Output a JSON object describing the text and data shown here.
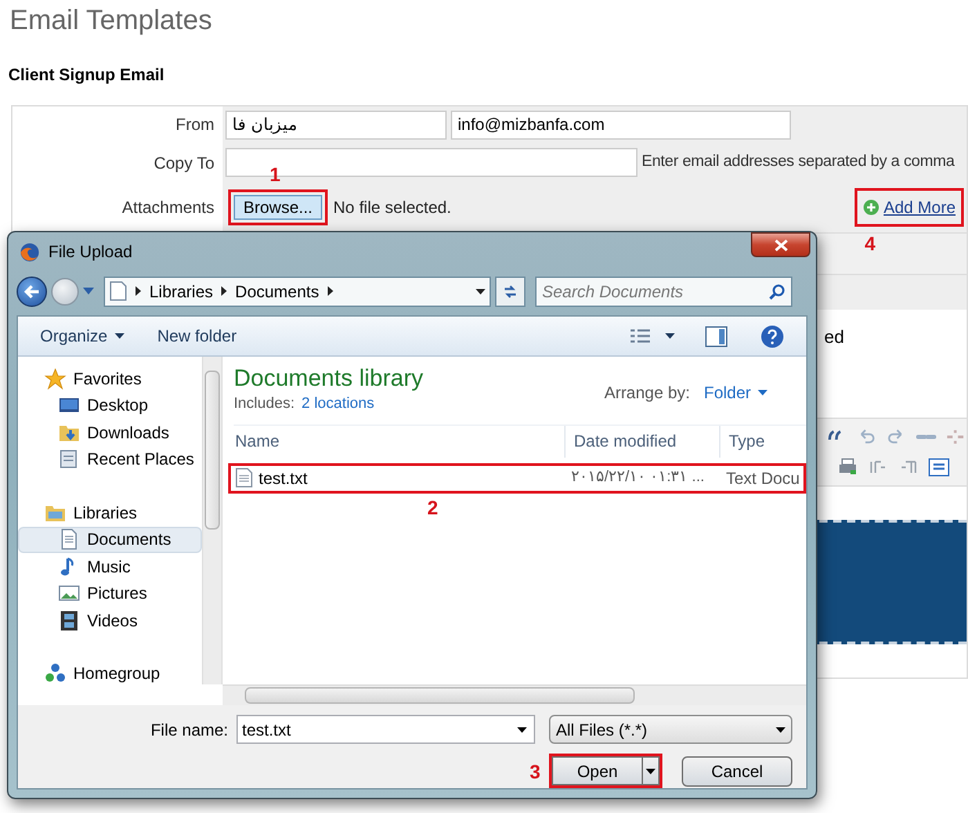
{
  "page": {
    "title": "Email Templates",
    "section": "Client Signup Email"
  },
  "form": {
    "from": {
      "label": "From",
      "name_value": "میزبان فا",
      "email_value": "info@mizbanfa.com"
    },
    "copy_to": {
      "label": "Copy To",
      "hint": "Enter email addresses separated by a comma"
    },
    "attachments": {
      "label": "Attachments",
      "browse": "Browse...",
      "status": "No file selected.",
      "add_more": "Add More"
    },
    "cut_text": "ed"
  },
  "dialog": {
    "title": "File Upload",
    "breadcrumb": [
      "Libraries",
      "Documents"
    ],
    "search": {
      "placeholder": "Search Documents"
    },
    "toolbar": [
      "Organize",
      "New folder"
    ],
    "nav": [
      {
        "label": "Favorites",
        "selected": false,
        "children": [
          {
            "label": "Desktop",
            "selected": false
          },
          {
            "label": "Downloads",
            "selected": false
          },
          {
            "label": "Recent Places",
            "selected": false
          }
        ]
      },
      {
        "label": "Libraries",
        "selected": false,
        "children": [
          {
            "label": "Documents",
            "selected": true
          },
          {
            "label": "Music",
            "selected": false
          },
          {
            "label": "Pictures",
            "selected": false
          },
          {
            "label": "Videos",
            "selected": false
          }
        ]
      },
      {
        "label": "Homegroup",
        "selected": false
      }
    ],
    "library": {
      "title": "Documents library",
      "includes_label": "Includes:",
      "includes_link": "2 locations",
      "arrange_label": "Arrange by:",
      "arrange_value": "Folder"
    },
    "columns": [
      "Name",
      "Date modified",
      "Type"
    ],
    "files": [
      {
        "name": "test.txt",
        "date": "۲۰۱۵/۲۲/۱۰ ۰۱:۳۱ ...",
        "type": "Text Docu",
        "selected": false
      }
    ],
    "file_name": {
      "label": "File name:",
      "value": "test.txt"
    },
    "filter": "All Files (*.*)",
    "buttons": {
      "open": "Open",
      "cancel": "Cancel"
    }
  },
  "annotations": [
    "1",
    "2",
    "3",
    "4"
  ]
}
